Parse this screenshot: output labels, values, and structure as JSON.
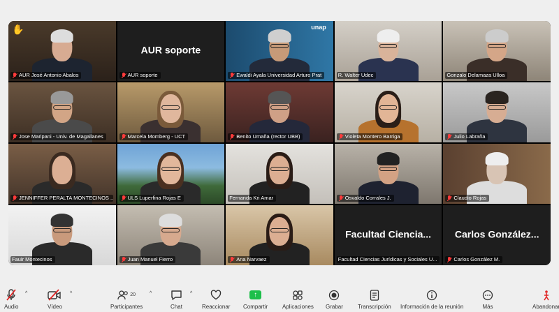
{
  "gallery": {
    "tiles": [
      {
        "name": "AUR José Antonio Abalos",
        "muted": true,
        "hand_raised": true
      },
      {
        "name": "AUR soporte",
        "muted": true,
        "center_label": "AUR soporte"
      },
      {
        "name": "Ewaldi Ayala Universidad Arturo Prat",
        "muted": true,
        "logo_text": "unap"
      },
      {
        "name": "R. Walter Udec",
        "muted": false
      },
      {
        "name": "Gonzalo Delamaza Ulloa",
        "muted": false
      },
      {
        "name": "Jose Maripani - Univ. de Magallanes",
        "muted": true
      },
      {
        "name": "Marcela Momberg - UCT",
        "muted": true
      },
      {
        "name": "Benito Umaña (rector UBB)",
        "muted": true
      },
      {
        "name": "Violeta Montero Barriga",
        "muted": true
      },
      {
        "name": "Julio Labraña",
        "muted": true
      },
      {
        "name": "JENNIFFER PERALTA MONTECINOS ...",
        "muted": true
      },
      {
        "name": "ULS Luperfina Rojas E",
        "muted": true
      },
      {
        "name": "Fernanda Kri Amar",
        "muted": false
      },
      {
        "name": "Osvaldo Corrales J.",
        "muted": true
      },
      {
        "name": "Claudio Rojas",
        "muted": true
      },
      {
        "name": "Fauir Montecinos",
        "muted": false
      },
      {
        "name": "Juan Manuel Fierro",
        "muted": true
      },
      {
        "name": "Ana Narvaez",
        "muted": true
      },
      {
        "name": "Facultad Ciencias Jurídicas y Sociales U...",
        "muted": false,
        "center_label": "Facultad Ciencia..."
      },
      {
        "name": "Carlos González M.",
        "muted": true,
        "center_label": "Carlos González..."
      }
    ]
  },
  "toolbar": {
    "audio": "Audio",
    "video": "Vídeo",
    "participants": "Participantes",
    "participants_count": "20",
    "chat": "Chat",
    "react": "Reaccionar",
    "share": "Compartir",
    "apps": "Aplicaciones",
    "record": "Grabar",
    "transcript": "Transcripción",
    "meeting_info": "Información de la reunión",
    "more": "Más",
    "leave": "Abandonar"
  },
  "colors": {
    "accent_green": "#1dbf4a",
    "muted_red": "#ff3b3b",
    "active_border": "#30c86a"
  }
}
